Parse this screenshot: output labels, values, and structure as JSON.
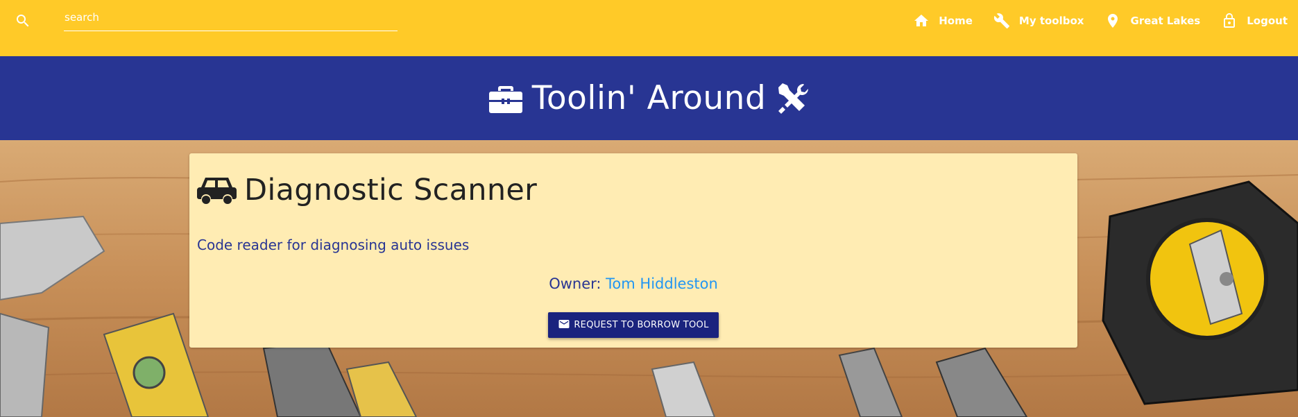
{
  "search": {
    "placeholder": "search"
  },
  "nav": {
    "items": [
      {
        "label": "Home",
        "icon": "home-icon"
      },
      {
        "label": "My toolbox",
        "icon": "wrench-icon"
      },
      {
        "label": "Great Lakes",
        "icon": "location-pin-icon"
      },
      {
        "label": "Logout",
        "icon": "lock-icon"
      }
    ]
  },
  "banner": {
    "title": "Toolin' Around",
    "left_icon": "toolbox-icon",
    "right_icon": "tools-icon"
  },
  "tool": {
    "icon": "car-icon",
    "name": "Diagnostic Scanner",
    "description": "Code reader for diagnosing auto issues",
    "owner_label": "Owner:",
    "owner_name": "Tom Hiddleston",
    "borrow_label": "REQUEST TO BORROW TOOL",
    "borrow_icon": "mail-icon"
  },
  "colors": {
    "nav_bg": "#ffca28",
    "banner_bg": "#283593",
    "card_bg": "#ffecb3",
    "button_bg": "#1a237e",
    "link": "#2196f3"
  }
}
